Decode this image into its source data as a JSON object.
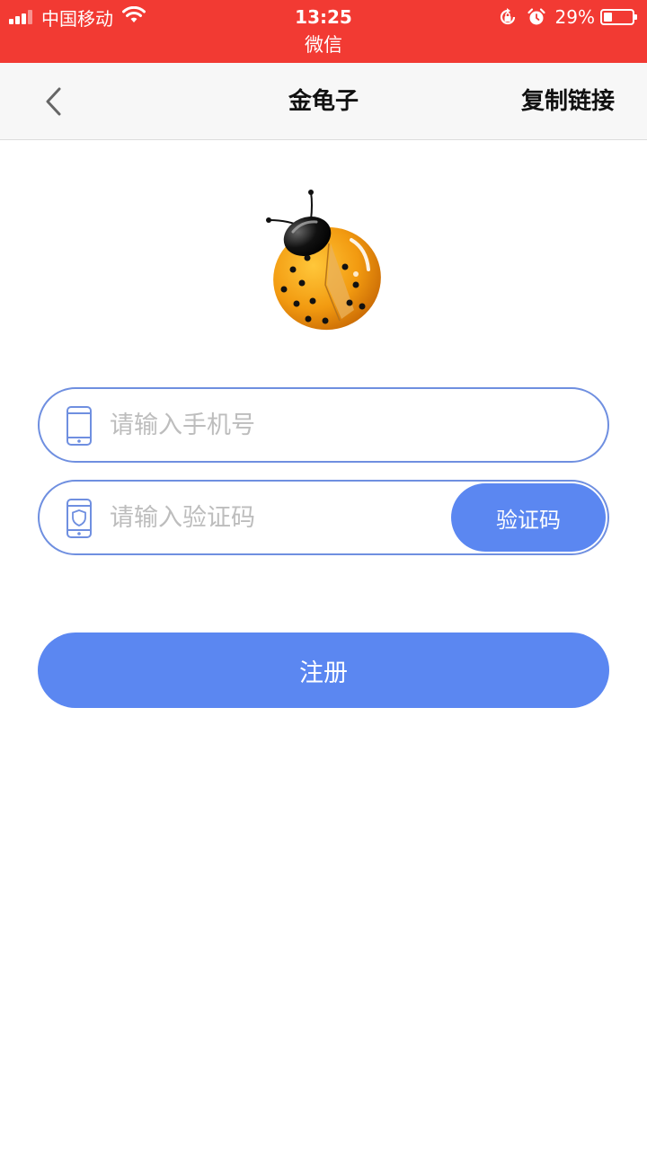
{
  "status_bar": {
    "carrier": "中国移动",
    "time": "13:25",
    "app_label": "微信",
    "battery": "29%",
    "battery_level": 0.29,
    "icons": [
      "signal-icon",
      "wifi-icon",
      "orientation-lock-icon",
      "alarm-icon",
      "battery-icon"
    ]
  },
  "nav": {
    "back_icon": "chevron-left-icon",
    "title": "金龟子",
    "copy_link": "复制链接"
  },
  "logo": {
    "icon": "ladybug-logo"
  },
  "form": {
    "phone": {
      "icon": "phone-icon",
      "placeholder": "请输入手机号",
      "value": ""
    },
    "code": {
      "icon": "phone-shield-icon",
      "placeholder": "请输入验证码",
      "value": "",
      "button_label": "验证码"
    },
    "register_label": "注册"
  },
  "colors": {
    "status_bar": "#f23a33",
    "accent": "#5b87f1",
    "field_border": "#6f8fe0",
    "nav_bg": "#f7f7f7",
    "placeholder": "#bdbdbd"
  }
}
